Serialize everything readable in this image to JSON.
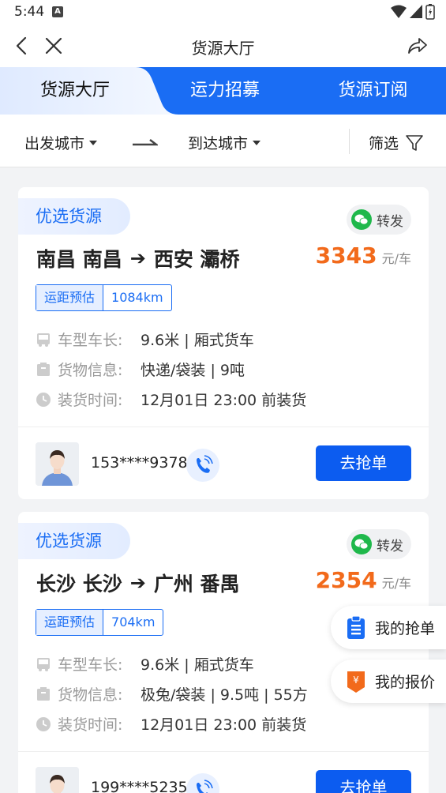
{
  "status": {
    "time": "5:44",
    "a_icon": "A"
  },
  "nav": {
    "title": "货源大厅"
  },
  "tabs": [
    {
      "label": "货源大厅",
      "active": true
    },
    {
      "label": "运力招募",
      "active": false
    },
    {
      "label": "货源订阅",
      "active": false
    }
  ],
  "filters": {
    "from": "出发城市",
    "to": "到达城市",
    "filter": "筛选"
  },
  "labels": {
    "badge": "优选货源",
    "forward": "转发",
    "price_unit": "元/车",
    "distance": "运距预估",
    "vehicle": "车型车长:",
    "cargo": "货物信息:",
    "load_time": "装货时间:",
    "grab": "去抢单"
  },
  "cards": [
    {
      "from": "南昌 南昌",
      "to": "西安 灞桥",
      "price": "3343",
      "distance": "1084km",
      "vehicle": "9.6米 | 厢式货车",
      "cargo": "快递/袋装 | 9吨",
      "load_time": "12月01日  23:00  前装货",
      "phone": "153****9378"
    },
    {
      "from": "长沙 长沙",
      "to": "广州 番禺",
      "price": "2354",
      "distance": "704km",
      "vehicle": "9.6米 | 厢式货车",
      "cargo": "极兔/袋装 | 9.5吨 | 55方",
      "load_time": "12月01日  23:00  前装货",
      "phone": "199****5235"
    }
  ],
  "floating": {
    "my_orders": "我的抢单",
    "my_quotes": "我的报价"
  },
  "colors": {
    "primary": "#1a6df4",
    "price": "#f26a1b",
    "button": "#0c5cf0"
  }
}
